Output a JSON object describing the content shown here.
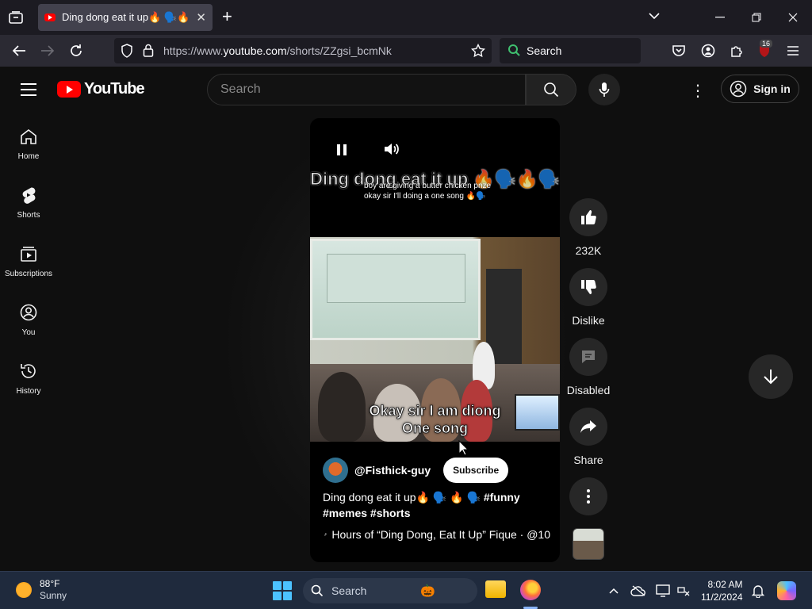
{
  "browser": {
    "tab_title": "Ding dong eat it up🔥 🗣️🔥",
    "url_prefix": "https://www.",
    "url_host": "youtube.com",
    "url_path": "/shorts/ZZgsi_bcmNk",
    "search_placeholder": "Search",
    "extension_badge": "16"
  },
  "youtube": {
    "logo_text": "YouTube",
    "search_placeholder": "Search",
    "sign_in_label": "Sign in",
    "sidebar": [
      {
        "label": "Home",
        "icon": "home-icon"
      },
      {
        "label": "Shorts",
        "icon": "shorts-icon"
      },
      {
        "label": "Subscriptions",
        "icon": "subscriptions-icon"
      },
      {
        "label": "You",
        "icon": "you-icon"
      },
      {
        "label": "History",
        "icon": "history-icon"
      }
    ]
  },
  "short": {
    "overlay_title": "Ding dong eat it up 🔥🗣️🔥🗣️",
    "overlay_small_line1": "boy are giving a butter chicken prize",
    "overlay_small_line2": "okay sir I'll doing a one song 🔥🗣️",
    "video_caption_line1": "Okay sir I am diong",
    "video_caption_line2": "One song",
    "channel": "@Fisthick-guy",
    "subscribe_label": "Subscribe",
    "title_text": "Ding dong eat it up🔥 🗣️ 🔥 🗣️",
    "title_tags_1": "#funny",
    "title_tags_2": "#memes #shorts",
    "sound_text": "Hours of “Ding Dong, Eat It Up” Fique · @10"
  },
  "actions": {
    "like_count": "232K",
    "dislike_label": "Dislike",
    "comments_label": "Disabled",
    "share_label": "Share"
  },
  "taskbar": {
    "temperature": "88°F",
    "weather": "Sunny",
    "search_placeholder": "Search",
    "time": "8:02 AM",
    "date": "11/2/2024"
  },
  "colors": {
    "yt_red": "#ff0000",
    "background": "#0f0f0f",
    "button_grey": "#272727",
    "firefox_tab": "#42414d"
  }
}
